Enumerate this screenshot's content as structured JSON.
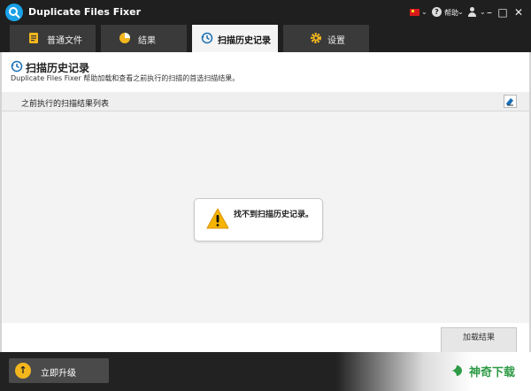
{
  "app": {
    "title": "Duplicate Files Fixer"
  },
  "titlebar": {
    "help_label": "帮助",
    "chevron": "⌄",
    "minimize": "–",
    "maximize": "□",
    "close": "✕"
  },
  "tabs": [
    {
      "label": "普通文件",
      "icon": "document-icon"
    },
    {
      "label": "结果",
      "icon": "pie-chart-icon"
    },
    {
      "label": "扫描历史记录",
      "icon": "history-icon",
      "active": true
    },
    {
      "label": "设置",
      "icon": "gear-icon"
    }
  ],
  "history": {
    "title": "扫描历史记录",
    "description": "Duplicate Files Fixer 帮助加载和查看之前执行的扫描的首选扫描结果。",
    "list_header": "之前执行的扫描结果列表",
    "empty_message": "找不到扫描历史记录。",
    "load_button": "加载结果"
  },
  "footer": {
    "upgrade_label": "立即升级",
    "watermark": "神奇下载"
  },
  "colors": {
    "accent": "#1aa0e6",
    "upgrade": "#f3b71d",
    "warning": "#f5b400",
    "watermark": "#2e9a46"
  }
}
